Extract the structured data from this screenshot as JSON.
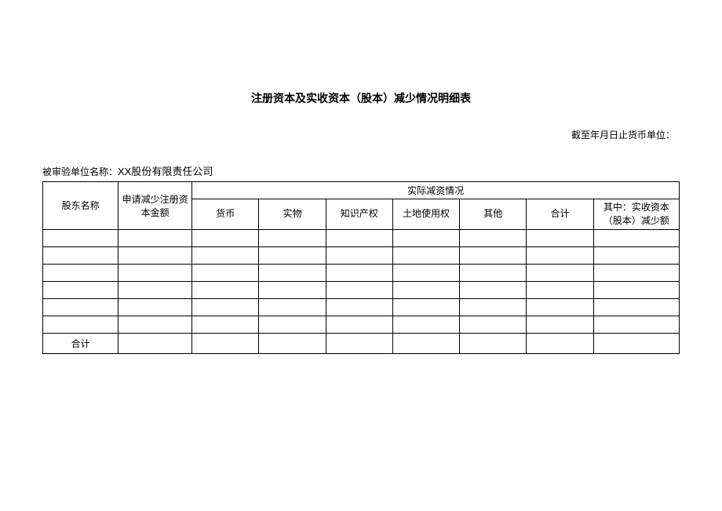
{
  "title": "注册资本及实收资本（股本）减少情况明细表",
  "subtitle": "截至年月日止货币单位：",
  "entity_label": "被审验单位名称：",
  "entity_value": "XX股份有限责任公司",
  "headers": {
    "shareholder_name": "股东名称",
    "apply_reduce": "申请减少注册资本金额",
    "actual_reduce": "实际减资情况",
    "currency": "货币",
    "physical": "实物",
    "ip": "知识产权",
    "land": "土地使用权",
    "other": "其他",
    "total": "合计",
    "paidin_reduce": "其中：实收资本（股本）减少额"
  },
  "rows": [
    {
      "name": "",
      "apply": "",
      "currency": "",
      "physical": "",
      "ip": "",
      "land": "",
      "other": "",
      "total": "",
      "paidin": ""
    },
    {
      "name": "",
      "apply": "",
      "currency": "",
      "physical": "",
      "ip": "",
      "land": "",
      "other": "",
      "total": "",
      "paidin": ""
    },
    {
      "name": "",
      "apply": "",
      "currency": "",
      "physical": "",
      "ip": "",
      "land": "",
      "other": "",
      "total": "",
      "paidin": ""
    },
    {
      "name": "",
      "apply": "",
      "currency": "",
      "physical": "",
      "ip": "",
      "land": "",
      "other": "",
      "total": "",
      "paidin": ""
    },
    {
      "name": "",
      "apply": "",
      "currency": "",
      "physical": "",
      "ip": "",
      "land": "",
      "other": "",
      "total": "",
      "paidin": ""
    },
    {
      "name": "",
      "apply": "",
      "currency": "",
      "physical": "",
      "ip": "",
      "land": "",
      "other": "",
      "total": "",
      "paidin": ""
    }
  ],
  "total_row": {
    "label": "合计",
    "apply": "",
    "currency": "",
    "physical": "",
    "ip": "",
    "land": "",
    "other": "",
    "total": "",
    "paidin": ""
  }
}
